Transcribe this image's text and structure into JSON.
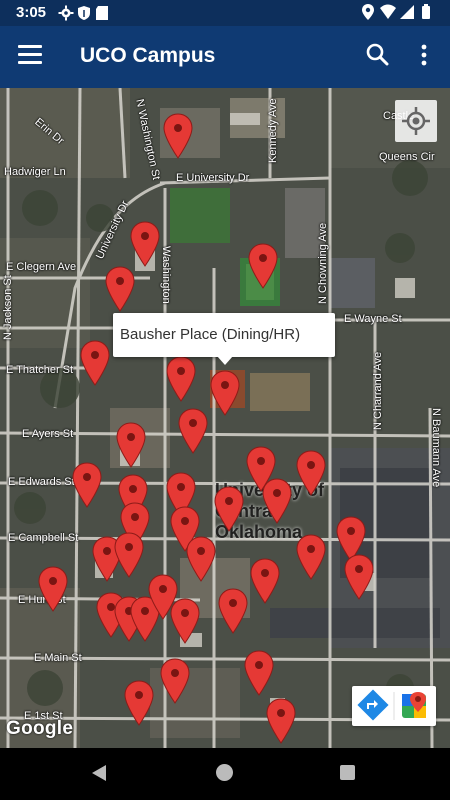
{
  "status_bar": {
    "time": "3:05",
    "left_icons": [
      "gear-icon",
      "shield-icon",
      "sd-card-icon"
    ],
    "right_icons": [
      "location-icon",
      "wifi-icon",
      "signal-icon",
      "battery-icon"
    ]
  },
  "app_bar": {
    "title": "UCO Campus",
    "menu_icon": "hamburger-icon",
    "search_icon": "search-icon",
    "more_icon": "more-vert-icon"
  },
  "map": {
    "type": "satellite",
    "streets": {
      "erin": "Erin Dr",
      "washington_n": "N Washington St",
      "kennedy": "Kennedy Ave",
      "castle": "Castle",
      "hadwiger": "Hadwiger Ln",
      "university_dr": "E University Dr",
      "university_dr_curve": "University Dr",
      "queens": "Queens Cir",
      "clegern": "E Clegern Ave",
      "washington_s": "Washington",
      "chowning": "N Chowning Ave",
      "jackson": "N Jackson St",
      "wayne": "E Wayne St",
      "thatcher": "E Thatcher St",
      "charrand": "N Charrand Ave",
      "baumann": "N Baumann Ave",
      "ayers": "E Ayers St",
      "edwards": "E Edwards St",
      "campbell": "E Campbell St",
      "hurd": "E Hurd St",
      "main": "E Main St",
      "first": "E 1st St"
    },
    "campus_label": [
      "University of",
      "Central",
      "Oklahoma"
    ],
    "marker_count": 41,
    "info_window": {
      "title": "Bausher Place (Dining/HR)"
    },
    "controls": {
      "my_location_icon": "my-location-icon",
      "directions_icon": "directions-icon",
      "google_maps_icon": "google-maps-icon"
    },
    "attribution": "Google"
  },
  "nav_bar": {
    "back_icon": "back-icon",
    "home_icon": "home-icon",
    "recents_icon": "recents-icon"
  },
  "colors": {
    "status_bar": "#0d2f5c",
    "app_bar": "#0f3a73",
    "marker": "#e53935"
  }
}
